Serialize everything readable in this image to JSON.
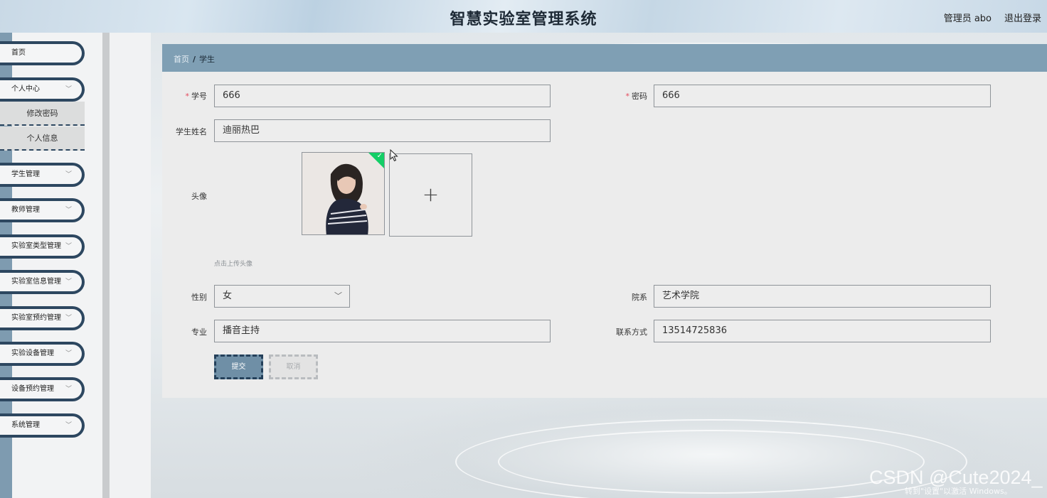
{
  "header": {
    "title": "智慧实验室管理系统",
    "user": "管理员 abo",
    "logout": "退出登录"
  },
  "sidebar": {
    "items": [
      {
        "label": "首页",
        "has_children": false
      },
      {
        "label": "个人中心",
        "has_children": true,
        "expanded": true
      },
      {
        "label": "学生管理",
        "has_children": true
      },
      {
        "label": "教师管理",
        "has_children": true
      },
      {
        "label": "实验室类型管理",
        "has_children": true
      },
      {
        "label": "实验室信息管理",
        "has_children": true
      },
      {
        "label": "实验室预约管理",
        "has_children": true
      },
      {
        "label": "实验设备管理",
        "has_children": true
      },
      {
        "label": "设备预约管理",
        "has_children": true
      },
      {
        "label": "系统管理",
        "has_children": true
      }
    ],
    "submenu": [
      "修改密码",
      "个人信息"
    ],
    "chevron": "chevron-down-icon"
  },
  "breadcrumb": {
    "home": "首页",
    "separator": "/",
    "current": "学生"
  },
  "form": {
    "student_id": {
      "label": "学号",
      "value": "666",
      "required": true
    },
    "password": {
      "label": "密码",
      "value": "666",
      "required": true
    },
    "name": {
      "label": "学生姓名",
      "value": "迪丽热巴"
    },
    "avatar": {
      "label": "头像",
      "tip": "点击上传头像",
      "upload_icon": "+"
    },
    "gender": {
      "label": "性别",
      "value": "女"
    },
    "department": {
      "label": "院系",
      "value": "艺术学院"
    },
    "major": {
      "label": "专业",
      "value": "播音主持"
    },
    "phone": {
      "label": "联系方式",
      "value": "13514725836"
    },
    "required_mark": "*"
  },
  "buttons": {
    "submit": "提交",
    "cancel": "取消"
  },
  "watermark": {
    "line1": "CSDN @Cute2024_",
    "line2": "转到\"设置\"以激活 Windows。"
  },
  "colors": {
    "accent": "#2d4760",
    "breadcrumb_bar": "#7f9fb4",
    "success": "#13ce66",
    "required": "#e4485b"
  }
}
